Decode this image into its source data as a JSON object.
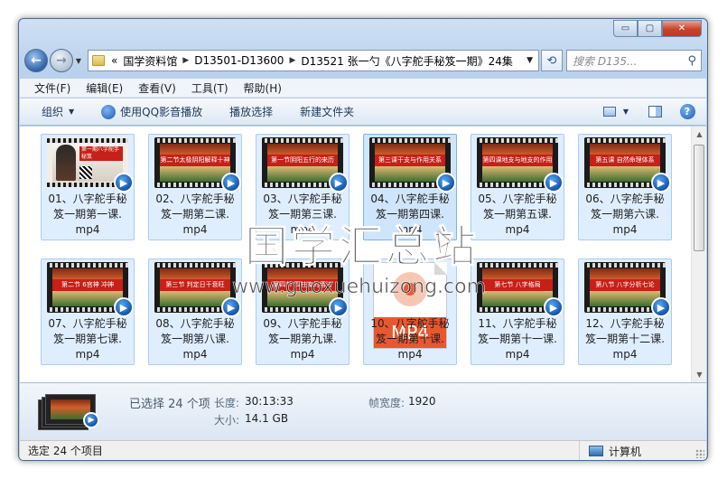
{
  "window": {
    "caption_buttons": {
      "minimize": "▭",
      "maximize": "▢",
      "close": "✕"
    }
  },
  "address": {
    "prefix": "«",
    "crumbs": [
      "国学资料馆",
      "D13501-D13600",
      "D13521 张一勺《八字舵手秘笈一期》24集"
    ],
    "search_placeholder": "搜索 D135..."
  },
  "menu": [
    "文件(F)",
    "编辑(E)",
    "查看(V)",
    "工具(T)",
    "帮助(H)"
  ],
  "toolbar": {
    "organize": "组织",
    "play_qq": "使用QQ影音播放",
    "play_selection": "播放选择",
    "new_folder": "新建文件夹"
  },
  "files": [
    {
      "line1": "01、八字舵手秘",
      "line2": "笈一期第一课.",
      "line3": "mp4",
      "thumb": "portrait",
      "banner": "第一期八字舵手秘笈"
    },
    {
      "line1": "02、八字舵手秘",
      "line2": "笈一期第二课.",
      "line3": "mp4",
      "thumb": "video",
      "banner": "第二节太极阴阳解释十神"
    },
    {
      "line1": "03、八字舵手秘",
      "line2": "笈一期第三课.",
      "line3": "mp4",
      "thumb": "video",
      "banner": "第一节阴阳五行的来历"
    },
    {
      "line1": "04、八字舵手秘",
      "line2": "笈一期第四课.",
      "line3": "mp4",
      "thumb": "video",
      "banner": "第三课干支与作用关系"
    },
    {
      "line1": "05、八字舵手秘",
      "line2": "笈一期第五课.",
      "line3": "mp4",
      "thumb": "video",
      "banner": "第四课地支与地支的作用"
    },
    {
      "line1": "06、八字舵手秘",
      "line2": "笈一期第六课.",
      "line3": "mp4",
      "thumb": "video",
      "banner": "第五课 自然命理体系"
    },
    {
      "line1": "07、八字舵手秘",
      "line2": "笈一期第七课.",
      "line3": "mp4",
      "thumb": "video",
      "banner": "第二节 6宫神 冲神"
    },
    {
      "line1": "08、八字舵手秘",
      "line2": "笈一期第八课.",
      "line3": "mp4",
      "thumb": "video",
      "banner": "第三节 判定日干衰旺"
    },
    {
      "line1": "09、八字舵手秘",
      "line2": "笈一期第九课.",
      "line3": "mp4",
      "thumb": "video",
      "banner": "第四节 四柱库的用法"
    },
    {
      "line1": "10、八字舵手秘",
      "line2": "笈一期第十课.",
      "line3": "mp4",
      "thumb": "mp4",
      "banner": ""
    },
    {
      "line1": "11、八字舵手秘",
      "line2": "笈一期第十一课.",
      "line3": "mp4",
      "thumb": "video",
      "banner": "第七节 八字格局"
    },
    {
      "line1": "12、八字舵手秘",
      "line2": "笈一期第十二课.",
      "line3": "mp4",
      "thumb": "video",
      "banner": "第八节 八字分析七论"
    }
  ],
  "mp4_label": "MP4",
  "watermark": {
    "title": "国学汇总站",
    "url": "www.guoxuehuizong.com"
  },
  "details": {
    "selected": "已选择 24 个项",
    "length_label": "长度:",
    "length_value": "30:13:33",
    "size_label": "大小:",
    "size_value": "14.1 GB",
    "frame_width_label": "帧宽度:",
    "frame_width_value": "1920"
  },
  "status": {
    "left": "选定 24 个项目",
    "right": "计算机"
  },
  "colors": {
    "accent": "#2f62a8",
    "banner_red": "#c62018",
    "mp4_orange": "#e8582f",
    "selection": "#dfeeff"
  }
}
